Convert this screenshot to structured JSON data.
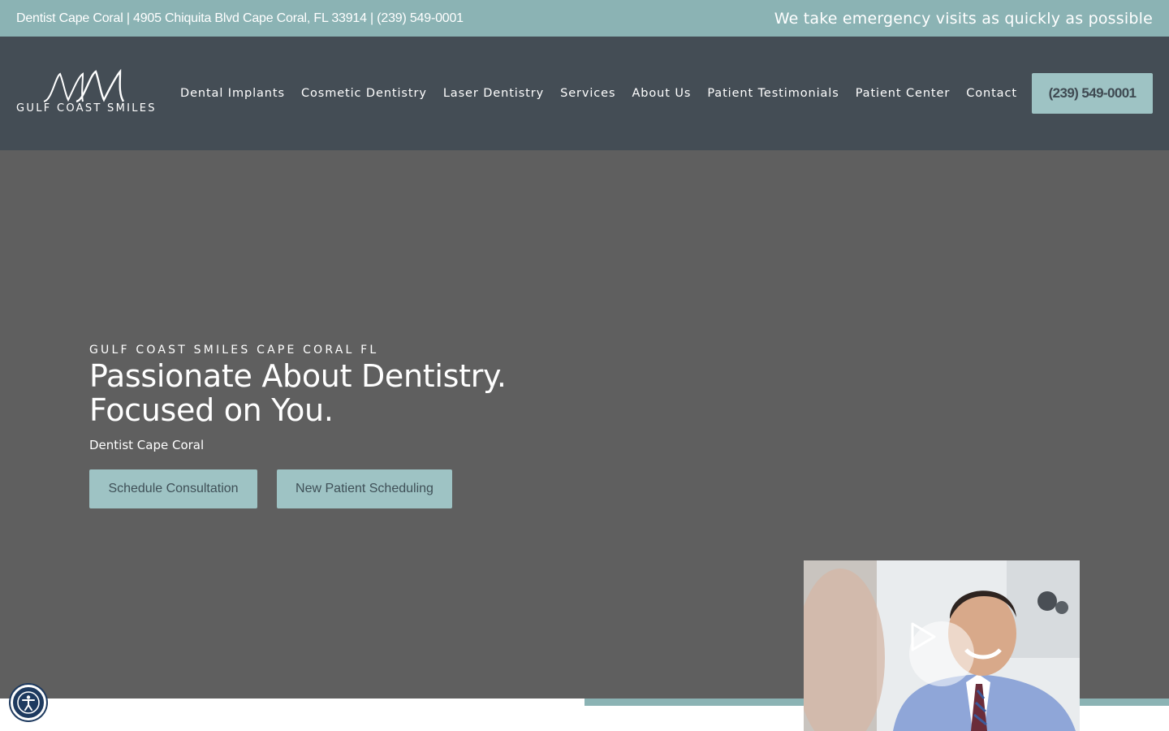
{
  "topbar": {
    "info": "Dentist Cape Coral | 4905 Chiquita Blvd Cape Coral, FL 33914 | (239) 549-0001",
    "emergency": "We take emergency visits as quickly as possible"
  },
  "logo": {
    "monogram": "MM",
    "name": "GULF COAST SMILES"
  },
  "nav": {
    "items": [
      {
        "label": "Dental Implants"
      },
      {
        "label": "Cosmetic Dentistry"
      },
      {
        "label": "Laser Dentistry"
      },
      {
        "label": "Services"
      },
      {
        "label": "About Us"
      },
      {
        "label": "Patient Testimonials"
      },
      {
        "label": "Patient Center"
      },
      {
        "label": "Contact"
      }
    ],
    "phone": "(239) 549-0001"
  },
  "hero": {
    "eyebrow": "GULF COAST SMILES CAPE CORAL FL",
    "title_line1": "Passionate About Dentistry.",
    "title_line2": "Focused on You.",
    "subtitle": "Dentist Cape Coral",
    "button_consult": "Schedule Consultation",
    "button_new_patient": "New Patient Scheduling"
  },
  "video": {
    "icon": "play-icon"
  },
  "accessibility": {
    "icon": "accessibility-icon"
  },
  "colors": {
    "topbar": "#8bb3b4",
    "header": "#444d55",
    "hero": "#5f5f5f",
    "button": "#9ec3c4"
  }
}
